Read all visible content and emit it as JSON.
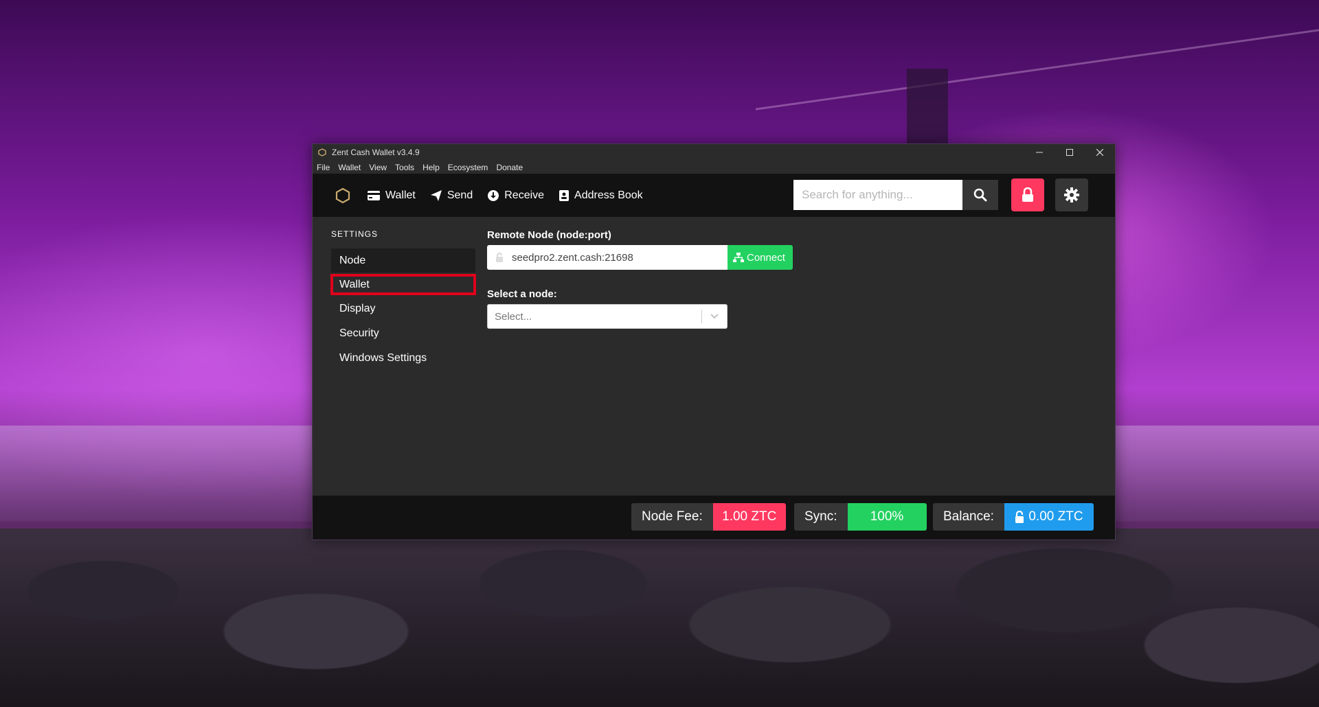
{
  "window": {
    "title": "Zent Cash Wallet v3.4.9",
    "controls": [
      "minimize",
      "maximize",
      "close"
    ]
  },
  "menubar": {
    "items": [
      "File",
      "Wallet",
      "View",
      "Tools",
      "Help",
      "Ecosystem",
      "Donate"
    ]
  },
  "navbar": {
    "links": [
      {
        "label": "Wallet",
        "icon": "wallet-icon"
      },
      {
        "label": "Send",
        "icon": "paper-plane-icon"
      },
      {
        "label": "Receive",
        "icon": "download-circle-icon"
      },
      {
        "label": "Address Book",
        "icon": "address-book-icon"
      }
    ],
    "search_placeholder": "Search for anything...",
    "accent_lock": "#ff3860"
  },
  "sidebar": {
    "heading": "SETTINGS",
    "items": [
      {
        "label": "Node"
      },
      {
        "label": "Wallet"
      },
      {
        "label": "Display"
      },
      {
        "label": "Security"
      },
      {
        "label": "Windows Settings"
      }
    ]
  },
  "main": {
    "remote_node_label": "Remote Node (node:port)",
    "remote_node_value": "seedpro2.zent.cash:21698",
    "connect_label": "Connect",
    "select_node_label": "Select a node:",
    "select_placeholder": "Select..."
  },
  "footer": {
    "node_fee_label": "Node Fee:",
    "node_fee_value": "1.00 ZTC",
    "sync_label": "Sync:",
    "sync_value": "100%",
    "balance_label": "Balance:",
    "balance_value": "0.00 ZTC",
    "colors": {
      "fee": "#ff3860",
      "sync": "#23d160",
      "balance": "#209cee"
    }
  }
}
